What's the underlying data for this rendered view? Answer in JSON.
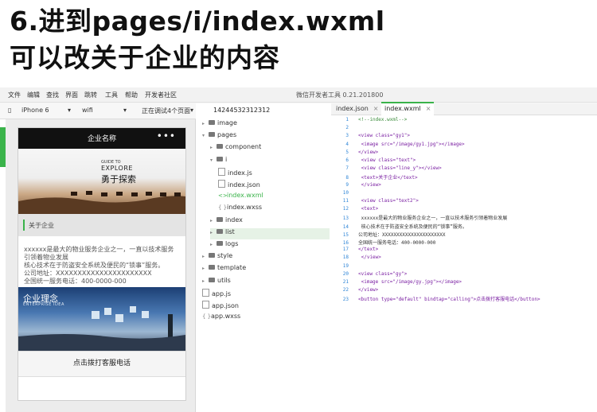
{
  "headings": {
    "line1": "6.进到pages/i/index.wxml",
    "line2": "可以改关于企业的内容"
  },
  "ide": {
    "menu": [
      "文件",
      "编辑",
      "查找",
      "界面",
      "跳转",
      "工具",
      "帮助",
      "开发者社区"
    ],
    "window_title": "微信开发者工具 0.21.201800",
    "toolbar": {
      "device": "iPhone 6",
      "network": "wifi",
      "status": "正在调试4个页面"
    },
    "phone": {
      "nav_title": "企业名称",
      "nav_dots": "•••",
      "banner1_small": "GUIDE TO",
      "banner1_big": "EXPLORE",
      "banner1_calli": "勇于探索",
      "section_label": "关于企业",
      "about_text": [
        "xxxxxx是最大的物业服务企业之一，一直以技术服务",
        "引领着物业发展",
        "核心技术在于防盗安全系统及便民的“锁事”服务。",
        "公司地址：XXXXXXXXXXXXXXXXXXXXXX",
        "全国统一服务电话：400-0000-000"
      ],
      "banner2_title": "企业理念",
      "banner2_sub": "ENTERPRISE IDEA",
      "call_button": "点击拨打客服电话"
    },
    "tree": {
      "project": "14244532312312",
      "items": [
        {
          "label": "image",
          "type": "folder",
          "indent": 0
        },
        {
          "label": "pages",
          "type": "folder-open",
          "indent": 0
        },
        {
          "label": "component",
          "type": "folder",
          "indent": 1
        },
        {
          "label": "i",
          "type": "folder-open",
          "indent": 1
        },
        {
          "label": "index.js",
          "type": "js",
          "indent": 2
        },
        {
          "label": "index.json",
          "type": "json",
          "indent": 2
        },
        {
          "label": "index.wxml",
          "type": "wxml",
          "indent": 2
        },
        {
          "label": "index.wxss",
          "type": "wxss",
          "indent": 2
        },
        {
          "label": "index",
          "type": "folder",
          "indent": 1
        },
        {
          "label": "list",
          "type": "folder",
          "indent": 1
        },
        {
          "label": "logs",
          "type": "folder",
          "indent": 1
        },
        {
          "label": "style",
          "type": "folder",
          "indent": 0
        },
        {
          "label": "template",
          "type": "folder",
          "indent": 0
        },
        {
          "label": "utils",
          "type": "folder",
          "indent": 0
        },
        {
          "label": "app.js",
          "type": "js",
          "indent": 0
        },
        {
          "label": "app.json",
          "type": "json",
          "indent": 0
        },
        {
          "label": "app.wxss",
          "type": "wxss",
          "indent": 0
        }
      ]
    },
    "editor": {
      "tabs": [
        {
          "label": "index.json",
          "close": "×"
        },
        {
          "label": "index.wxml",
          "close": "×"
        }
      ],
      "lines": [
        {
          "n": "1",
          "text": "<!--index.wxml-->"
        },
        {
          "n": "2",
          "text": ""
        },
        {
          "n": "3",
          "text": "<view class=\"gy1\">"
        },
        {
          "n": "4",
          "text": "    <image src=\"/image/gy1.jpg\"></image>"
        },
        {
          "n": "5",
          "text": "</view>"
        },
        {
          "n": "6",
          "text": " <view class=\"text\">"
        },
        {
          "n": "7",
          "text": "        <view class=\"line_y\"></view>"
        },
        {
          "n": "8",
          "text": "        <text>关于企业</text>"
        },
        {
          "n": "9",
          "text": "    </view>"
        },
        {
          "n": "10",
          "text": ""
        },
        {
          "n": "11",
          "text": "     <view class=\"text2\">"
        },
        {
          "n": "12",
          "text": "        <text>"
        },
        {
          "n": "13",
          "text": "   xxxxxx是最大的物业服务企业之一，一直以技术服务引领着物业发展"
        },
        {
          "n": "14",
          "text": "   核心技术在于防盗安全系统及便民的“锁事”服务。"
        },
        {
          "n": "15",
          "text": "公司地址：XXXXXXXXXXXXXXXXXXXXXX"
        },
        {
          "n": "16",
          "text": "全国统一服务电话：400-0000-000"
        },
        {
          "n": "17",
          "text": "</text>"
        },
        {
          "n": "18",
          "text": "     </view>"
        },
        {
          "n": "19",
          "text": ""
        },
        {
          "n": "20",
          "text": "<view class=\"gy\">"
        },
        {
          "n": "21",
          "text": "    <image src=\"/image/gy.jpg\"></image>"
        },
        {
          "n": "22",
          "text": "</view>"
        },
        {
          "n": "23",
          "text": "<button type=\"default\" bindtap=\"calling\">点击拨打客服电话</button>"
        }
      ]
    }
  },
  "colors": {
    "accent": "#3ab34a",
    "line_number": "#2d84d6",
    "tag": "#7a1fa2"
  }
}
